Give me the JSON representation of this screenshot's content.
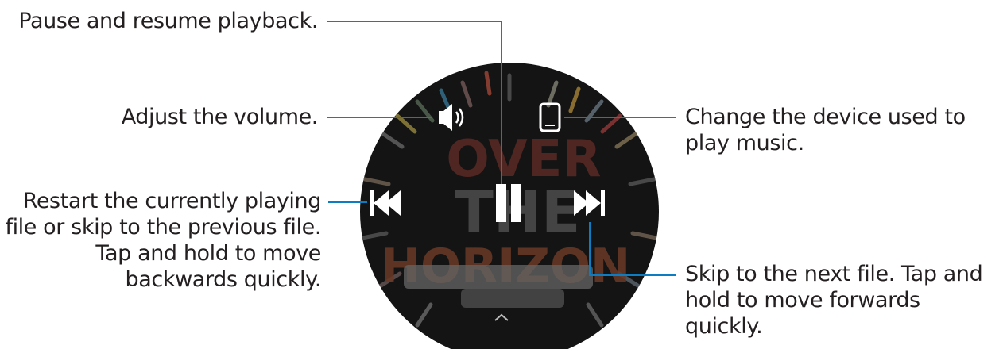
{
  "callouts": {
    "pause": "Pause and resume playback.",
    "volume": "Adjust the volume.",
    "device": "Change the device used to play music.",
    "previous": "Restart the currently playing file or skip to the previous file. Tap and hold to move backwards quickly.",
    "next": "Skip to the next file. Tap and hold to move forwards quickly."
  },
  "album_art_text": {
    "line1": "OVER",
    "line2": "THE",
    "line3": "HORIZON"
  },
  "icons": {
    "volume": "speaker-icon",
    "device": "phone-icon",
    "previous": "skip-previous-icon",
    "play_pause": "pause-icon",
    "next": "skip-next-icon",
    "more": "chevron-up-icon"
  },
  "colors": {
    "leader_line": "#0e7cc1",
    "watch_face": "#141414",
    "icon": "#ffffff"
  }
}
